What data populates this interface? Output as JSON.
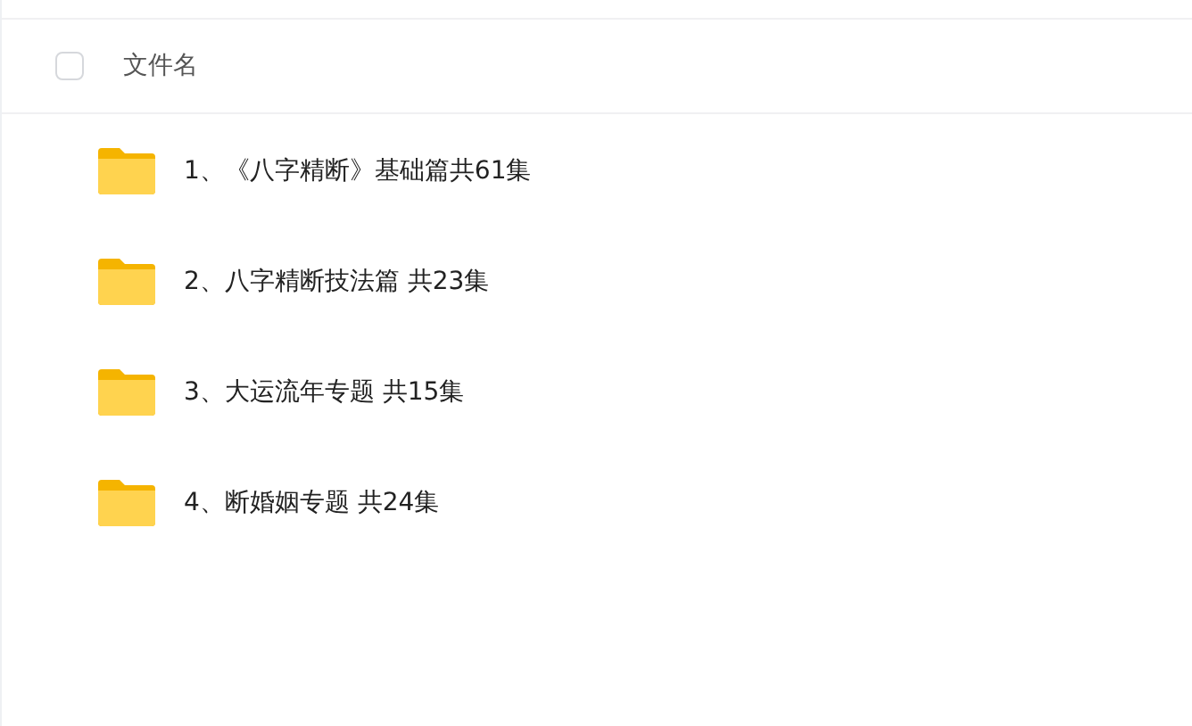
{
  "header": {
    "select_all": {
      "checked": false
    },
    "column_label": "文件名"
  },
  "files": [
    {
      "kind": "folder",
      "name": "1、《八字精断》基础篇共61集"
    },
    {
      "kind": "folder",
      "name": "2、八字精断技法篇 共23集"
    },
    {
      "kind": "folder",
      "name": "3、大运流年专题 共15集"
    },
    {
      "kind": "folder",
      "name": "4、断婚姻专题 共24集"
    }
  ]
}
